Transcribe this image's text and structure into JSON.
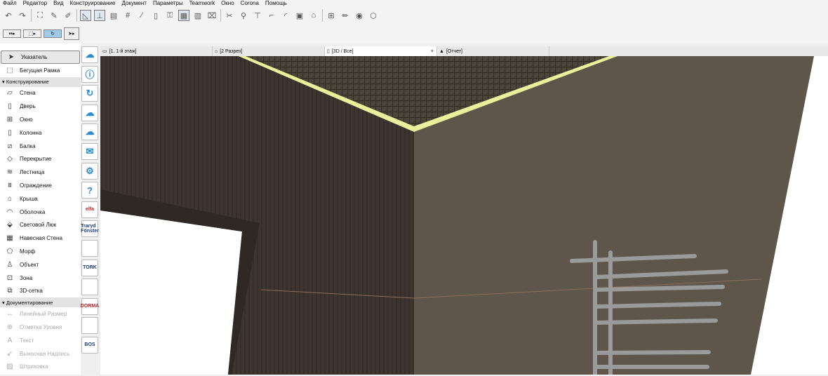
{
  "menu": [
    "Файл",
    "Редактор",
    "Вид",
    "Конструирование",
    "Документ",
    "Параметры",
    "Teamwork",
    "Окно",
    "Corona",
    "Помощь"
  ],
  "toolbox": {
    "top": [
      {
        "label": "Указатель",
        "icon": "pointer-icon",
        "selected": true
      },
      {
        "label": "Бегущая Рамка",
        "icon": "marquee-icon"
      }
    ],
    "section1": "Конструирование",
    "design": [
      {
        "label": "Стена",
        "icon": "wall-icon"
      },
      {
        "label": "Дверь",
        "icon": "door-icon"
      },
      {
        "label": "Окно",
        "icon": "window-icon"
      },
      {
        "label": "Колонна",
        "icon": "column-icon"
      },
      {
        "label": "Балка",
        "icon": "beam-icon"
      },
      {
        "label": "Перекрытие",
        "icon": "slab-icon"
      },
      {
        "label": "Лестница",
        "icon": "stair-icon"
      },
      {
        "label": "Ограждение",
        "icon": "railing-icon"
      },
      {
        "label": "Крыша",
        "icon": "roof-icon"
      },
      {
        "label": "Оболочка",
        "icon": "shell-icon"
      },
      {
        "label": "Световой Люк",
        "icon": "skylight-icon"
      },
      {
        "label": "Навесная Стена",
        "icon": "curtain-wall-icon"
      },
      {
        "label": "Морф",
        "icon": "morph-icon"
      },
      {
        "label": "Объект",
        "icon": "object-icon"
      },
      {
        "label": "Зона",
        "icon": "zone-icon"
      },
      {
        "label": "3D-сетка",
        "icon": "mesh-icon"
      }
    ],
    "section2": "Документирование",
    "document": [
      {
        "label": "Линейный Размер",
        "icon": "dimension-icon"
      },
      {
        "label": "Отметка Уровня",
        "icon": "level-icon"
      },
      {
        "label": "Текст",
        "icon": "text-icon"
      },
      {
        "label": "Выносная Надпись",
        "icon": "label-icon"
      },
      {
        "label": "Штриховка",
        "icon": "fill-icon"
      }
    ]
  },
  "plugins": [
    "",
    "",
    "",
    "",
    "",
    "",
    "",
    "",
    "elfa",
    "Traryd Fönster",
    "",
    "TORK",
    "",
    "DORMA",
    "",
    "BOS"
  ],
  "tabs": [
    {
      "label": "[1. 1-й этаж]"
    },
    {
      "label": "[2 Разрез]"
    },
    {
      "label": "[3D / Все]",
      "active": true
    },
    {
      "label": "[Отчет]"
    }
  ],
  "colors": {
    "left_wall": "#3f3530",
    "right_wall": "#5e554b",
    "ceiling": "#2e2a24",
    "light_strip": "#e9ef9a",
    "accent": "#2e8bd0"
  }
}
